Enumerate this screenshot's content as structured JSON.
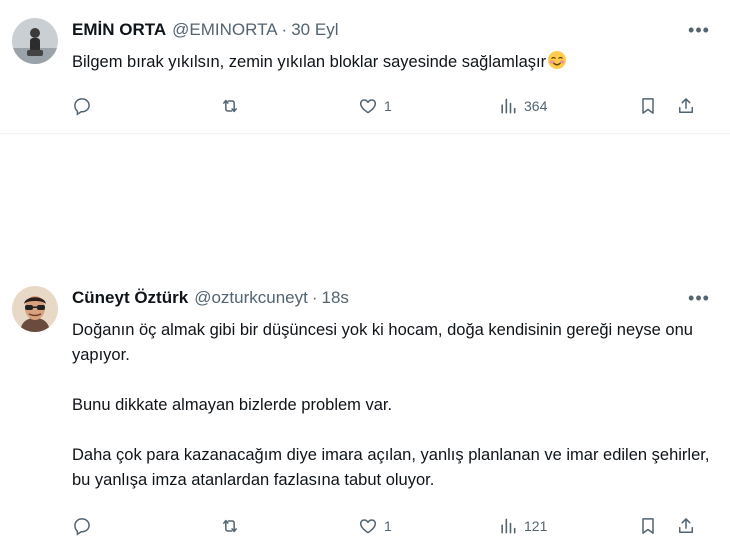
{
  "tweets": [
    {
      "name": "EMİN ORTA",
      "handle": "@EMINORTA",
      "separator": "·",
      "time": "30 Eyl",
      "more": "•••",
      "text": "Bilgem bırak yıkılsın, zemin yıkılan bloklar sayesinde sağlamlaşır",
      "emoji": "smiling-face-with-blush",
      "counts": {
        "replies": "",
        "retweets": "",
        "likes": "1",
        "views": "364"
      }
    },
    {
      "name": "Cüneyt Öztürk",
      "handle": "@ozturkcuneyt",
      "separator": "·",
      "time": "18s",
      "more": "•••",
      "paragraphs": [
        "Doğanın öç almak gibi bir düşüncesi yok ki hocam, doğa kendisinin gereği neyse onu yapıyor.",
        "Bunu dikkate almayan bizlerde problem var.",
        "Daha çok para kazanacağım diye imara açılan, yanlış planlanan ve imar edilen şehirler, bu yanlışa imza atanlardan fazlasına tabut oluyor."
      ],
      "counts": {
        "replies": "",
        "retweets": "",
        "likes": "1",
        "views": "121"
      }
    }
  ],
  "colors": {
    "text": "#0f1419",
    "secondary": "#536471",
    "divider": "#eff3f4"
  }
}
